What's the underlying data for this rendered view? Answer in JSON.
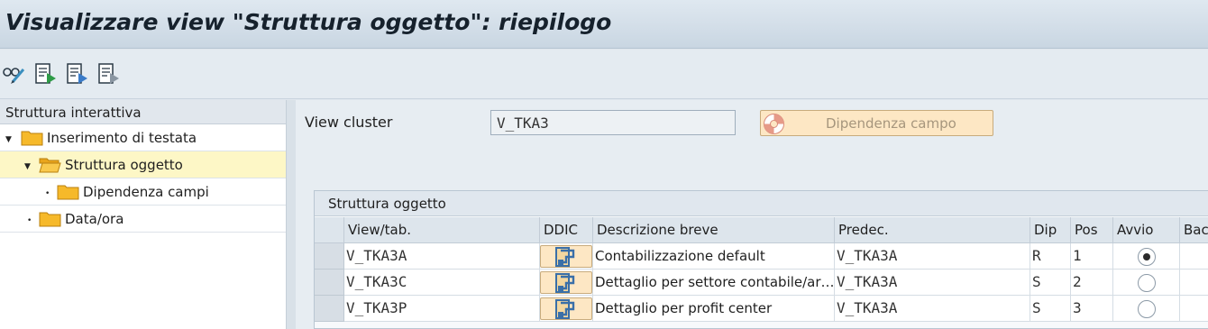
{
  "window": {
    "title": "Visualizzare view \"Struttura oggetto\": riepilogo"
  },
  "toolbar": {
    "icons": [
      "glasses-edit-icon",
      "change-docs-icon",
      "transport-docs-icon",
      "detail-docs-icon"
    ]
  },
  "tree": {
    "header": "Struttura interattiva",
    "items": [
      {
        "label": "Inserimento di testata",
        "expanded": true,
        "selected": false
      },
      {
        "label": "Struttura oggetto",
        "expanded": true,
        "selected": true
      },
      {
        "label": "Dipendenza campi",
        "expanded": false,
        "selected": false
      },
      {
        "label": "Data/ora",
        "expanded": false,
        "selected": false
      }
    ]
  },
  "form": {
    "view_cluster_label": "View cluster",
    "view_cluster_value": "V_TKA3",
    "dependency_button": "Dipendenza campo"
  },
  "table": {
    "title": "Struttura oggetto",
    "columns": [
      "View/tab.",
      "DDIC",
      "Descrizione breve",
      "Predec.",
      "Dip",
      "Pos",
      "Avvio",
      "Bac"
    ],
    "rows": [
      {
        "view": "V_TKA3A",
        "description": "Contabilizzazione default",
        "predec": "V_TKA3A",
        "dip": "R",
        "pos": "1",
        "start": true
      },
      {
        "view": "V_TKA3C",
        "description": "Dettaglio per settore contabile/ar…",
        "predec": "V_TKA3A",
        "dip": "S",
        "pos": "2",
        "start": false
      },
      {
        "view": "V_TKA3P",
        "description": "Dettaglio per profit center",
        "predec": "V_TKA3A",
        "dip": "S",
        "pos": "3",
        "start": false
      }
    ]
  },
  "colors": {
    "title_bg": "#c9d6e2",
    "selected_row": "#fdf7c6",
    "button_bg": "#fde7c4",
    "folder": "#f6b92a"
  }
}
